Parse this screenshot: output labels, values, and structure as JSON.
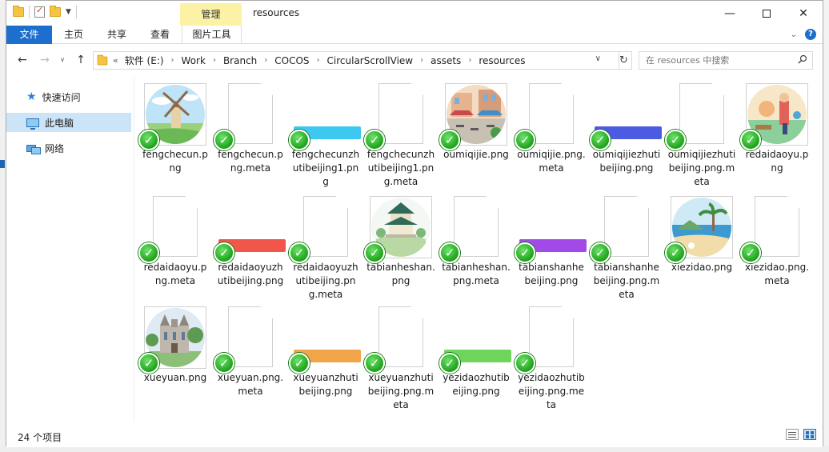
{
  "window": {
    "context_tab": "管理",
    "title": "resources"
  },
  "ribbon": {
    "tabs": [
      "文件",
      "主页",
      "共享",
      "查看",
      "图片工具"
    ]
  },
  "address": {
    "overflow": "«",
    "crumbs": [
      "软件 (E:)",
      "Work",
      "Branch",
      "COCOS",
      "CircularScrollView",
      "assets",
      "resources"
    ]
  },
  "search": {
    "placeholder": "在 resources 中搜索"
  },
  "nav": {
    "items": [
      "快速访问",
      "此电脑",
      "网络"
    ]
  },
  "files": [
    {
      "name": "fengchecun.png",
      "thumb": "windmill"
    },
    {
      "name": "fengchecun.png.meta",
      "thumb": "doc"
    },
    {
      "name": "fengchecunzhutibeijing1.png",
      "thumb": "bar",
      "color": "#3cc8f0"
    },
    {
      "name": "fengchecunzhutibeijing1.png.meta",
      "thumb": "doc"
    },
    {
      "name": "oumiqijie.png",
      "thumb": "street"
    },
    {
      "name": "oumiqijie.png.meta",
      "thumb": "doc"
    },
    {
      "name": "oumiqijiezhutibeijing.png",
      "thumb": "bar",
      "color": "#4d5be0"
    },
    {
      "name": "oumiqijiezhutibeijing.png.meta",
      "thumb": "doc"
    },
    {
      "name": "redaidaoyu.png",
      "thumb": "island"
    },
    {
      "name": "redaidaoyu.png.meta",
      "thumb": "doc"
    },
    {
      "name": "redaidaoyuzhutibeijing.png",
      "thumb": "bar",
      "color": "#f0564a"
    },
    {
      "name": "redaidaoyuzhutibeijing.png.meta",
      "thumb": "doc"
    },
    {
      "name": "tabianheshan.png",
      "thumb": "pavilion"
    },
    {
      "name": "tabianheshan.png.meta",
      "thumb": "doc"
    },
    {
      "name": "tabianshanhebeijing.png",
      "thumb": "bar",
      "color": "#a24ae8"
    },
    {
      "name": "tabianshanhebeijing.png.meta",
      "thumb": "doc"
    },
    {
      "name": "xiezidao.png",
      "thumb": "beach"
    },
    {
      "name": "xiezidao.png.meta",
      "thumb": "doc"
    },
    {
      "name": "xueyuan.png",
      "thumb": "college"
    },
    {
      "name": "xueyuan.png.meta",
      "thumb": "doc"
    },
    {
      "name": "xueyuanzhutibeijing.png",
      "thumb": "bar",
      "color": "#f0a54a"
    },
    {
      "name": "xueyuanzhutibeijing.png.meta",
      "thumb": "doc"
    },
    {
      "name": "yezidaozhutibeijing.png",
      "thumb": "bar",
      "color": "#6fd45c"
    },
    {
      "name": "yezidaozhutibeijing.png.meta",
      "thumb": "doc"
    }
  ],
  "status": {
    "count": "24 个项目"
  }
}
